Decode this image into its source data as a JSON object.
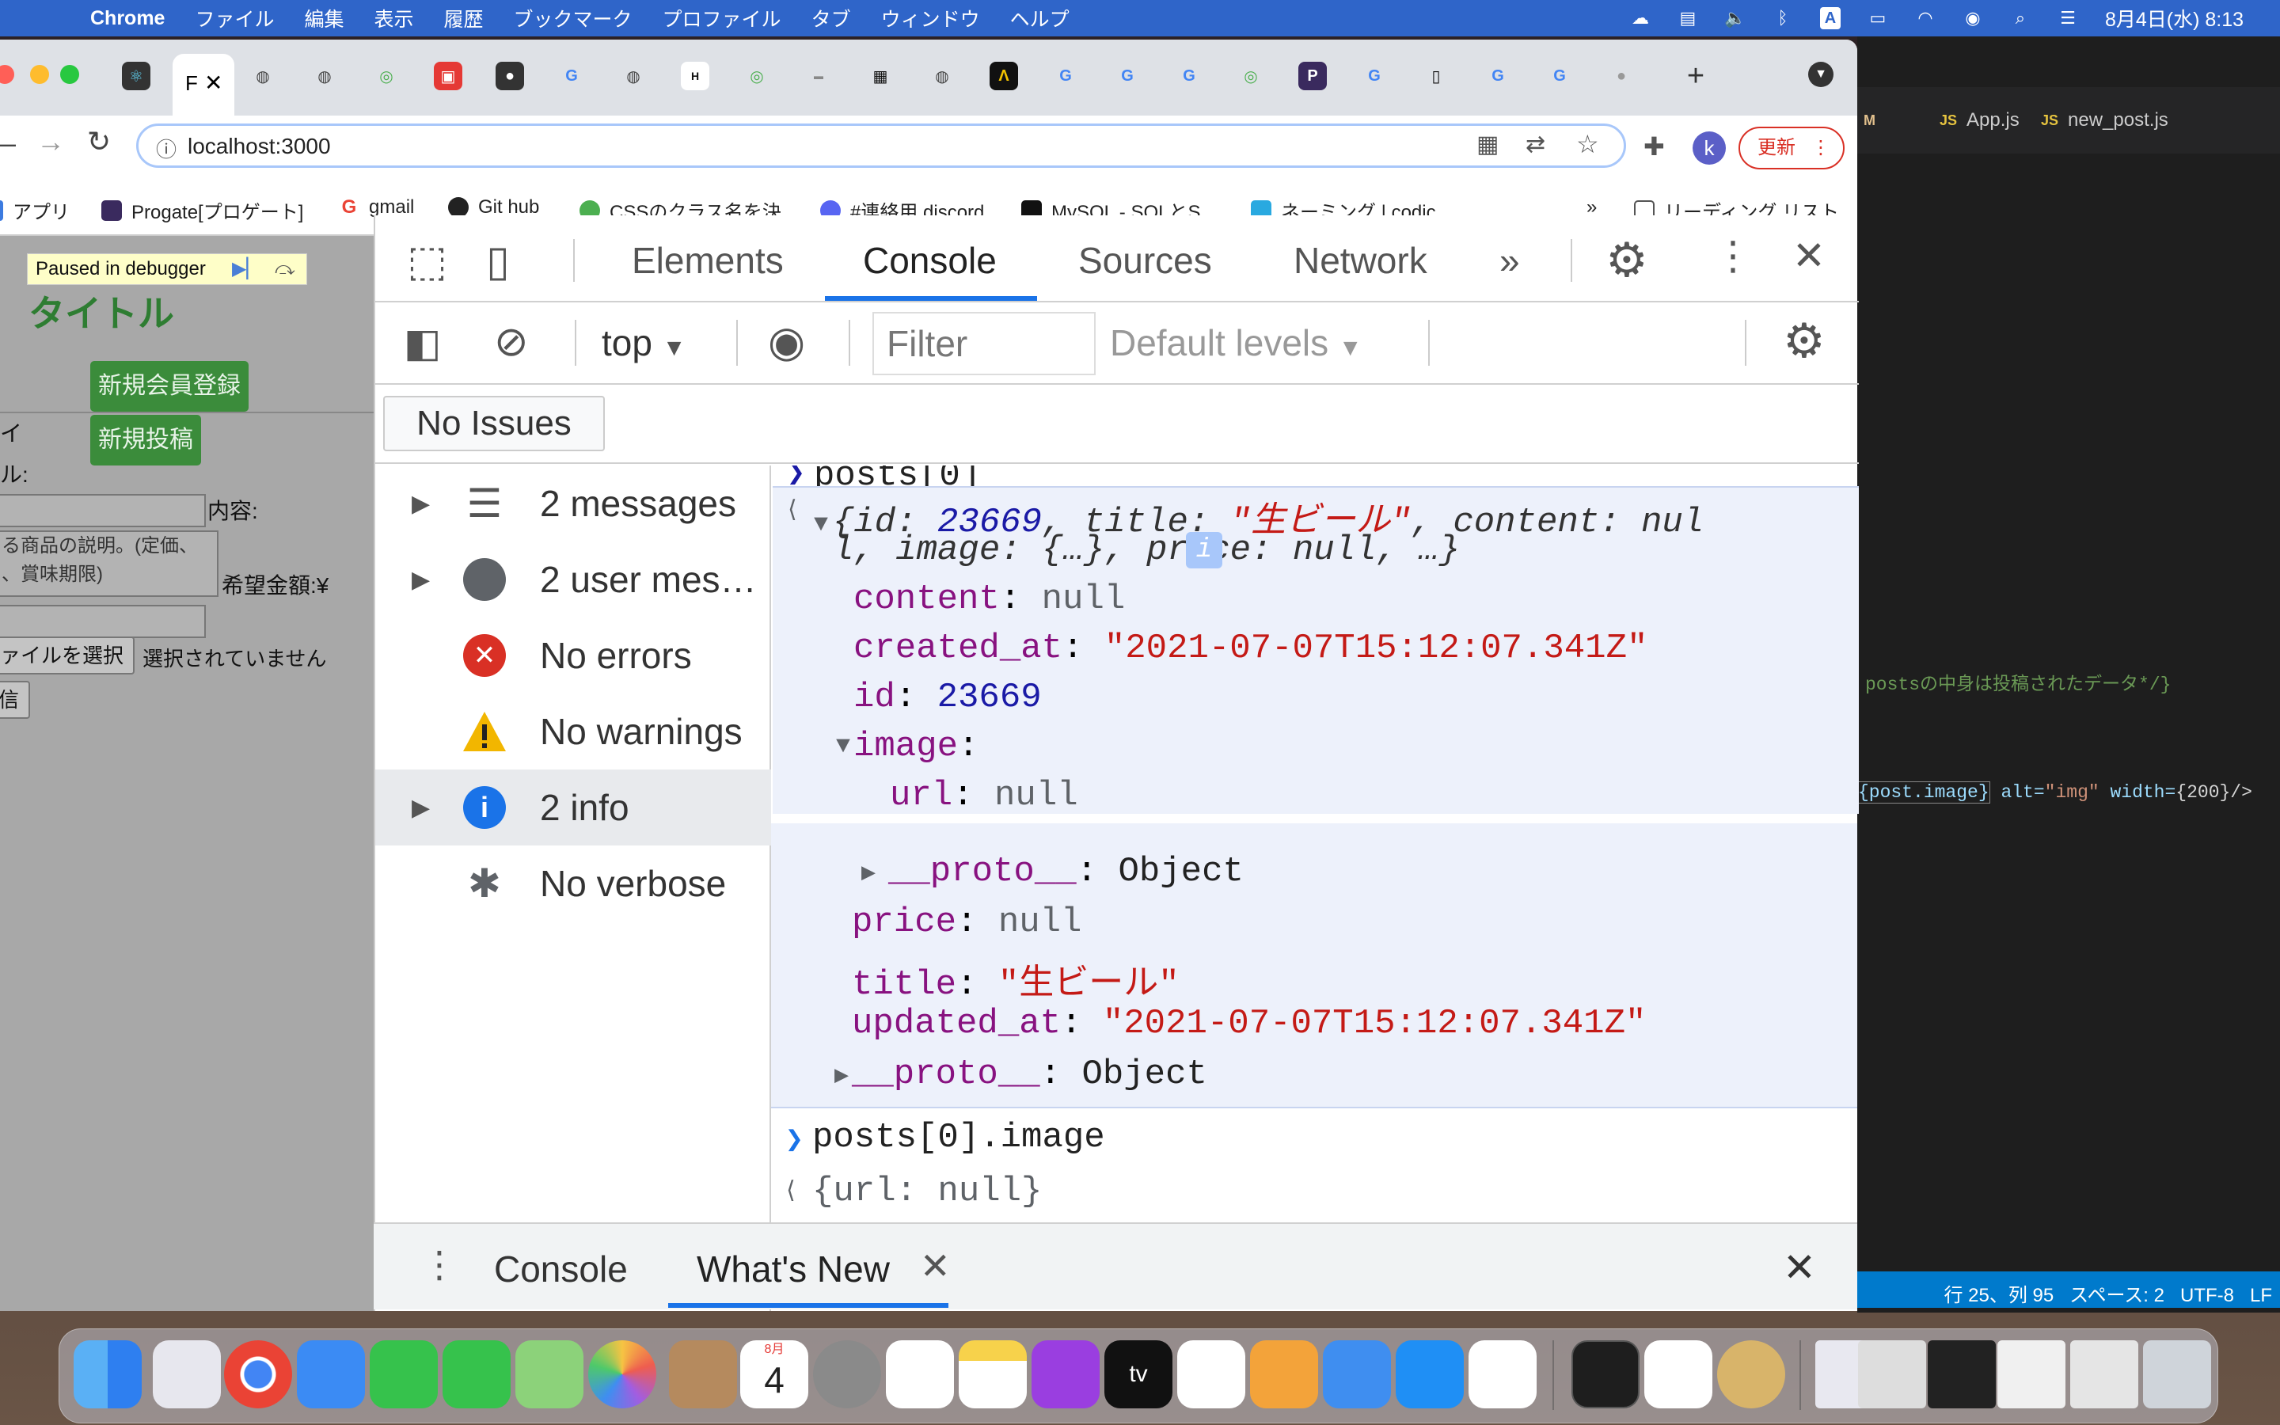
{
  "menubar": {
    "app_name": "Chrome",
    "items": [
      "ファイル",
      "編集",
      "表示",
      "履歴",
      "ブックマーク",
      "プロファイル",
      "タブ",
      "ウィンドウ",
      "ヘルプ"
    ],
    "status_a": "A",
    "clock": "8月4日(水) 8:13"
  },
  "browser": {
    "active_tab_text": "F",
    "url": "localhost:3000",
    "profile_initial": "k",
    "update_label": "更新",
    "bookmarks": [
      {
        "label": "アプリ",
        "color": "#3c7be0"
      },
      {
        "label": "Progate[プロゲート]",
        "color": "#3a2a5e"
      },
      {
        "label": "gmail",
        "color": "#ea4335"
      },
      {
        "label": "Git hub",
        "color": "#222222"
      },
      {
        "label": "CSSのクラス名を決...",
        "color": "#4caf50"
      },
      {
        "label": "#連絡用 discord",
        "color": "#5865f2"
      },
      {
        "label": "MySQL - SQLとS...",
        "color": "#111111"
      },
      {
        "label": "ネーミング | codic",
        "color": "#29a9e0"
      }
    ],
    "bookmarks_more": "»",
    "reading_list": "リーディング リスト"
  },
  "page": {
    "paused": "Paused in debugger",
    "title": "タイトル",
    "signup_button": "新規会員登録",
    "new_post_button": "新規投稿",
    "label_a": "イ",
    "label_b": "ル:",
    "content_label": "内容:",
    "textarea_text": "る商品の説明。(定価、\n、賞味期限)",
    "price_label": "希望金額:¥",
    "file_button": "ァイルを選択",
    "file_status": "選択されていません",
    "submit_button": "信"
  },
  "devtools": {
    "tabs": [
      "Elements",
      "Console",
      "Sources",
      "Network"
    ],
    "active_tab": "Console",
    "context": "top",
    "filter_placeholder": "Filter",
    "levels": "Default levels",
    "issues": "No Issues",
    "sidebar": [
      {
        "label": "2 messages",
        "icon": "list-icon",
        "expandable": true
      },
      {
        "label": "2 user mes…",
        "icon": "user-icon",
        "expandable": true
      },
      {
        "label": "No errors",
        "icon": "error-icon",
        "expandable": false
      },
      {
        "label": "No warnings",
        "icon": "warning-icon",
        "expandable": false
      },
      {
        "label": "2 info",
        "icon": "info-icon",
        "expandable": true,
        "selected": true
      },
      {
        "label": "No verbose",
        "icon": "bug-icon",
        "expandable": false
      }
    ],
    "console": {
      "cmd1": "posts[0]",
      "obj_prefix": "{",
      "obj_id_key": "id: ",
      "obj_id": "23669",
      "obj_title_key": ", title: ",
      "obj_title": "\"生ビール\"",
      "obj_content": ", content: nul",
      "obj_line2": "l, image: {…}, price: null, …}",
      "info_badge": "i",
      "props": [
        {
          "key": "content",
          "value": "null",
          "type": "null"
        },
        {
          "key": "created_at",
          "value": "\"2021-07-07T15:12:07.341Z\"",
          "type": "str"
        },
        {
          "key": "id",
          "value": "23669",
          "type": "num"
        }
      ],
      "image_key": "image",
      "image_url_key": "url",
      "image_url_val": "null",
      "proto_key": "__proto__",
      "proto_val": "Object",
      "props2": [
        {
          "key": "price",
          "value": "null",
          "type": "null"
        },
        {
          "key": "title",
          "value": "\"生ビール\"",
          "type": "str"
        },
        {
          "key": "updated_at",
          "value": "\"2021-07-07T15:12:07.341Z\"",
          "type": "str"
        }
      ],
      "cmd2": "posts[0].image",
      "result2": "{url: null}"
    },
    "drawer_tabs": [
      "Console",
      "What's New"
    ]
  },
  "vscode": {
    "tabs": [
      {
        "prefix": "M",
        "label": ""
      },
      {
        "prefix": "JS",
        "label": "App.js"
      },
      {
        "prefix": "JS",
        "label": "new_post.js"
      }
    ],
    "comment": "postsの中身は投稿されたデータ*/}",
    "code_a": "{post.image}",
    "code_b": " alt=",
    "code_c": "\"img\"",
    "code_d": " width=",
    "code_e": "{200}/>",
    "status": "行 25、列 95   スペース: 2   UTF-8   LF"
  },
  "dock": {
    "calendar_month": "8月",
    "calendar_day": "4",
    "tv_label": "tv"
  }
}
